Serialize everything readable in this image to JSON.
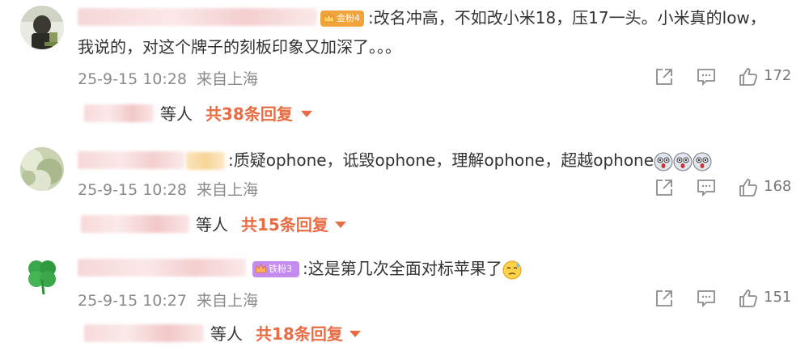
{
  "comments": [
    {
      "badge_label": "金粉4",
      "badge_color": "#f0a43a",
      "text_line1": ":改名冲高，不如改小米18，压17一头。小米真的low，",
      "text_line2": "我说的，对这个牌子的刻板印象又加深了。。。",
      "time": "25-9-15 10:28",
      "location": "来自上海",
      "likes": "172",
      "reply_suffix": "等人",
      "reply_total": "共38条回复"
    },
    {
      "text": ":质疑ophone，诋毁ophone，理解ophone，超越ophone",
      "time": "25-9-15 10:28",
      "location": "来自上海",
      "likes": "168",
      "reply_suffix": "等人",
      "reply_total": "共15条回复"
    },
    {
      "badge_label": "铁粉3",
      "badge_color": "#c48cf0",
      "text": ":这是第几次全面对标苹果了",
      "time": "25-9-15 10:27",
      "location": "来自上海",
      "likes": "151",
      "reply_suffix": "等人",
      "reply_total": "共18条回复"
    }
  ],
  "icons": {
    "share": "share-icon",
    "comment": "comment-icon",
    "like": "thumbs-up-icon",
    "expand": "caret-down-icon"
  },
  "colors": {
    "accent": "#e86c44",
    "meta_text": "#8a8a8a"
  }
}
